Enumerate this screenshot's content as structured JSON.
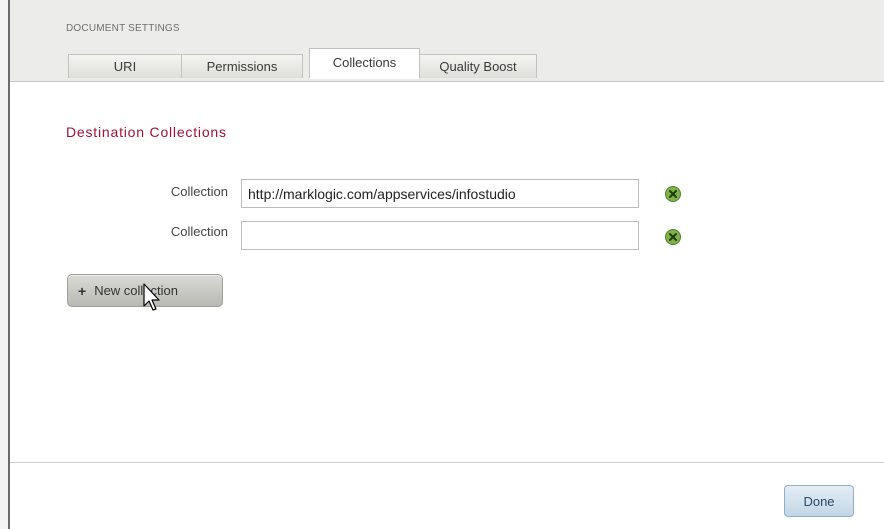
{
  "header": {
    "title": "DOCUMENT SETTINGS",
    "tabs": [
      {
        "label": "URI",
        "active": false
      },
      {
        "label": "Permissions",
        "active": false
      },
      {
        "label": "Collections",
        "active": true
      },
      {
        "label": "Quality Boost",
        "active": false
      }
    ]
  },
  "main": {
    "section_heading": "Destination Collections",
    "collections": [
      {
        "label": "Collection",
        "value": "http://marklogic.com/appservices/infostudio",
        "remove_icon": "remove-x-icon"
      },
      {
        "label": "Collection",
        "value": "",
        "remove_icon": "remove-x-icon"
      }
    ],
    "new_collection_button": {
      "icon": "plus-icon",
      "label": "New collection"
    }
  },
  "footer": {
    "done_label": "Done"
  },
  "colors": {
    "heading": "#a0103a",
    "header_bg": "#ececea",
    "remove_icon": "#5e9a2e",
    "done_button": "#c2d6e6"
  }
}
